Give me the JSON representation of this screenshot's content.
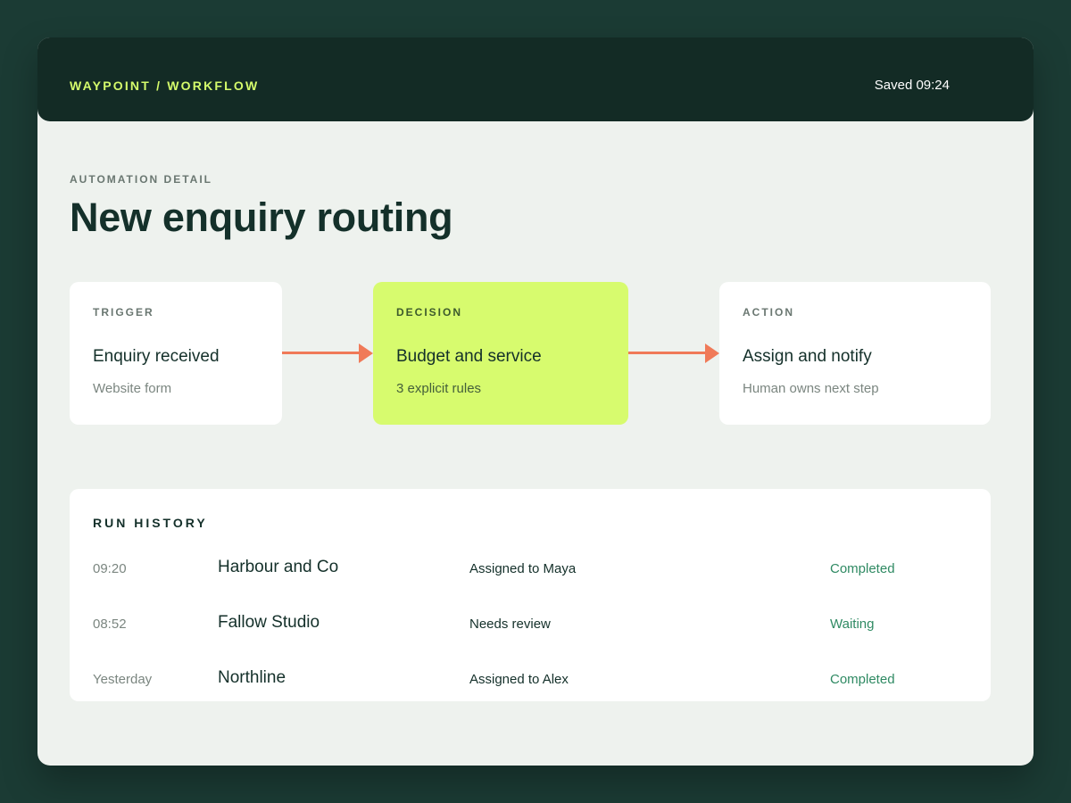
{
  "header": {
    "brand": "WAYPOINT / WORKFLOW",
    "saved": "Saved 09:24"
  },
  "page": {
    "eyebrow": "AUTOMATION DETAIL",
    "title": "New enquiry routing"
  },
  "flow": {
    "trigger": {
      "label": "TRIGGER",
      "title": "Enquiry received",
      "subtitle": "Website form"
    },
    "decision": {
      "label": "DECISION",
      "title": "Budget and service",
      "subtitle": "3 explicit rules"
    },
    "action": {
      "label": "ACTION",
      "title": "Assign and notify",
      "subtitle": "Human owns next step"
    },
    "arrow_color": "#f07a58",
    "decision_color": "#d7fb6e"
  },
  "run_history": {
    "title": "RUN HISTORY",
    "rows": [
      {
        "time": "09:20",
        "name": "Harbour and Co",
        "action": "Assigned to Maya",
        "status": "Completed"
      },
      {
        "time": "08:52",
        "name": "Fallow Studio",
        "action": "Needs review",
        "status": "Waiting"
      },
      {
        "time": "Yesterday",
        "name": "Northline",
        "action": "Assigned to Alex",
        "status": "Completed"
      }
    ]
  },
  "colors": {
    "background": "#1b3b34",
    "topbar": "#132b25",
    "brand_accent": "#d5fb6b",
    "status_green": "#2f8a63"
  }
}
